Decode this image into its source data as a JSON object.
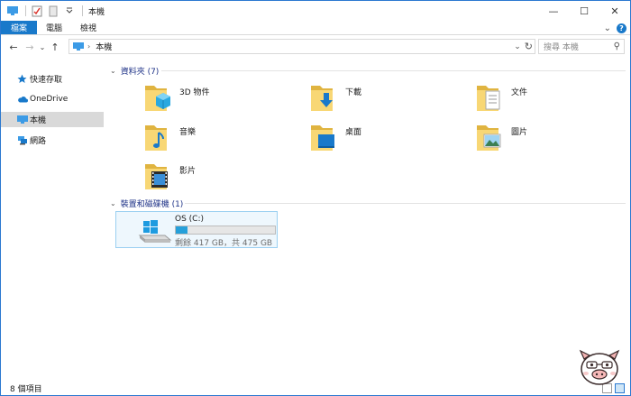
{
  "window": {
    "title": "本機",
    "controls": {
      "minimize": "—",
      "maximize": "☐",
      "close": "✕"
    }
  },
  "ribbon": {
    "tabs": [
      "檔案",
      "電腦",
      "檢視"
    ],
    "expand_glyph": "⌄",
    "help_glyph": "?"
  },
  "navigation": {
    "back": "←",
    "forward": "→",
    "recent": "⌄",
    "up": "↑",
    "address_path": "本機",
    "address_separator": "›",
    "refresh": "↻",
    "search_placeholder": "搜尋 本機",
    "search_icon": "⚲"
  },
  "sidebar": {
    "items": [
      {
        "label": "快速存取",
        "icon": "star-icon",
        "selected": false
      },
      {
        "label": "OneDrive",
        "icon": "cloud-icon",
        "selected": false
      },
      {
        "label": "本機",
        "icon": "computer-icon",
        "selected": true
      },
      {
        "label": "網路",
        "icon": "network-icon",
        "selected": false
      }
    ]
  },
  "folders_group": {
    "header": "資料夾 (7)",
    "items": [
      {
        "label": "3D 物件",
        "icon": "3d-objects-folder-icon"
      },
      {
        "label": "下載",
        "icon": "downloads-folder-icon"
      },
      {
        "label": "文件",
        "icon": "documents-folder-icon"
      },
      {
        "label": "音樂",
        "icon": "music-folder-icon"
      },
      {
        "label": "桌面",
        "icon": "desktop-folder-icon"
      },
      {
        "label": "圖片",
        "icon": "pictures-folder-icon"
      },
      {
        "label": "影片",
        "icon": "videos-folder-icon"
      }
    ]
  },
  "devices_group": {
    "header": "裝置和磁碟機 (1)",
    "drive": {
      "name": "OS (C:)",
      "free_text": "剩餘 417 GB，共 475 GB",
      "used_fraction": 0.122
    }
  },
  "status": {
    "item_count": "8 個項目"
  },
  "colors": {
    "accent": "#1979ca",
    "folder_yellow": "#f8d775",
    "folder_dark": "#e0b440",
    "drive_fill": "#26a0da",
    "group_header_text": "#1e3287",
    "selection_bg": "#d9d9d9"
  }
}
